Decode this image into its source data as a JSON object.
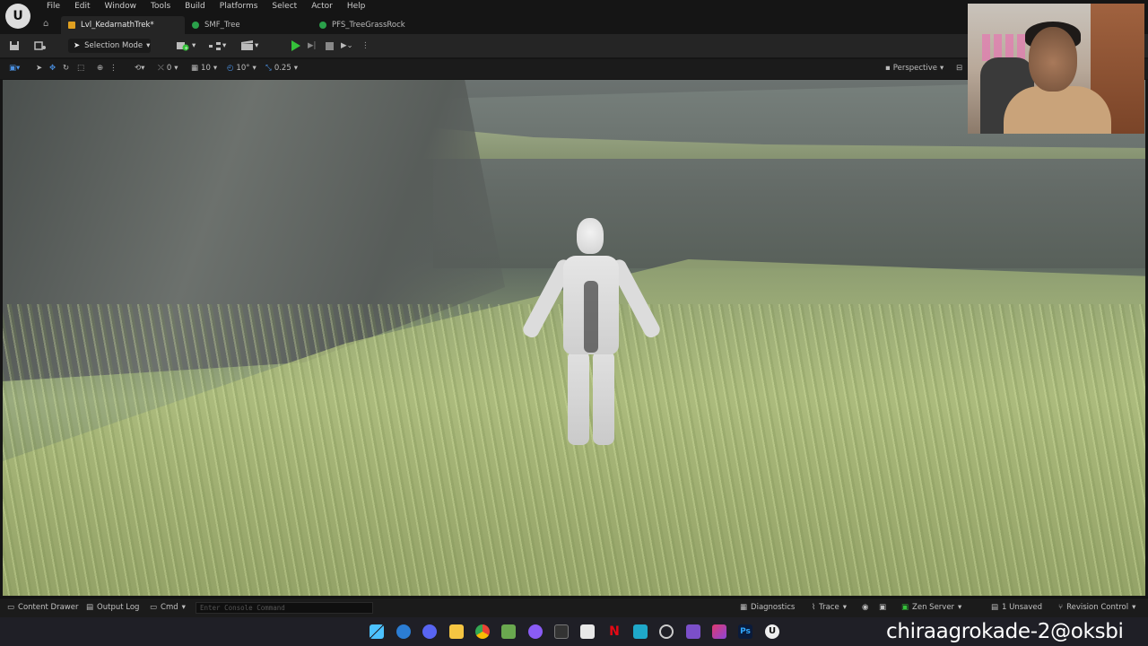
{
  "menu": [
    "File",
    "Edit",
    "Window",
    "Tools",
    "Build",
    "Select",
    "Actor",
    "Help",
    "Platforms"
  ],
  "menu_order": [
    "File",
    "Edit",
    "Window",
    "Tools",
    "Build",
    "Platforms",
    "Select",
    "Actor",
    "Help"
  ],
  "tabs": [
    {
      "label": "Lvl_KedarnathTrek*",
      "active": true,
      "icon_color": "#e0a020"
    },
    {
      "label": "SMF_Tree",
      "active": false,
      "icon_color": "#2aa04a"
    },
    {
      "label": "PFS_TreeGrassRock",
      "active": false,
      "icon_color": "#2aa04a"
    }
  ],
  "toolbar": {
    "selection_mode": "Selection Mode",
    "play_color": "#35c23a"
  },
  "viewport_toolbar": {
    "rotate_snap": "0",
    "grid_snap": "10",
    "angle_snap": "10°",
    "scale_snap": "0.25",
    "view_mode": "Perspective"
  },
  "statusbar": {
    "content_drawer": "Content Drawer",
    "output_log": "Output Log",
    "cmd": "Cmd",
    "console_placeholder": "Enter Console Command",
    "diagnostics": "Diagnostics",
    "trace": "Trace",
    "zen_server": "Zen Server",
    "unsaved": "1 Unsaved",
    "revision_control": "Revision Control"
  },
  "taskbar": {
    "overlay_text": "chiraagrokade-2@oksbi",
    "icons": [
      "windows-start",
      "edge",
      "discord",
      "file-explorer",
      "chrome",
      "minecraft",
      "github",
      "terminal",
      "notepad",
      "netflix",
      "app-3d",
      "overwolf",
      "visual-studio",
      "rider",
      "photoshop",
      "unreal-engine"
    ]
  }
}
